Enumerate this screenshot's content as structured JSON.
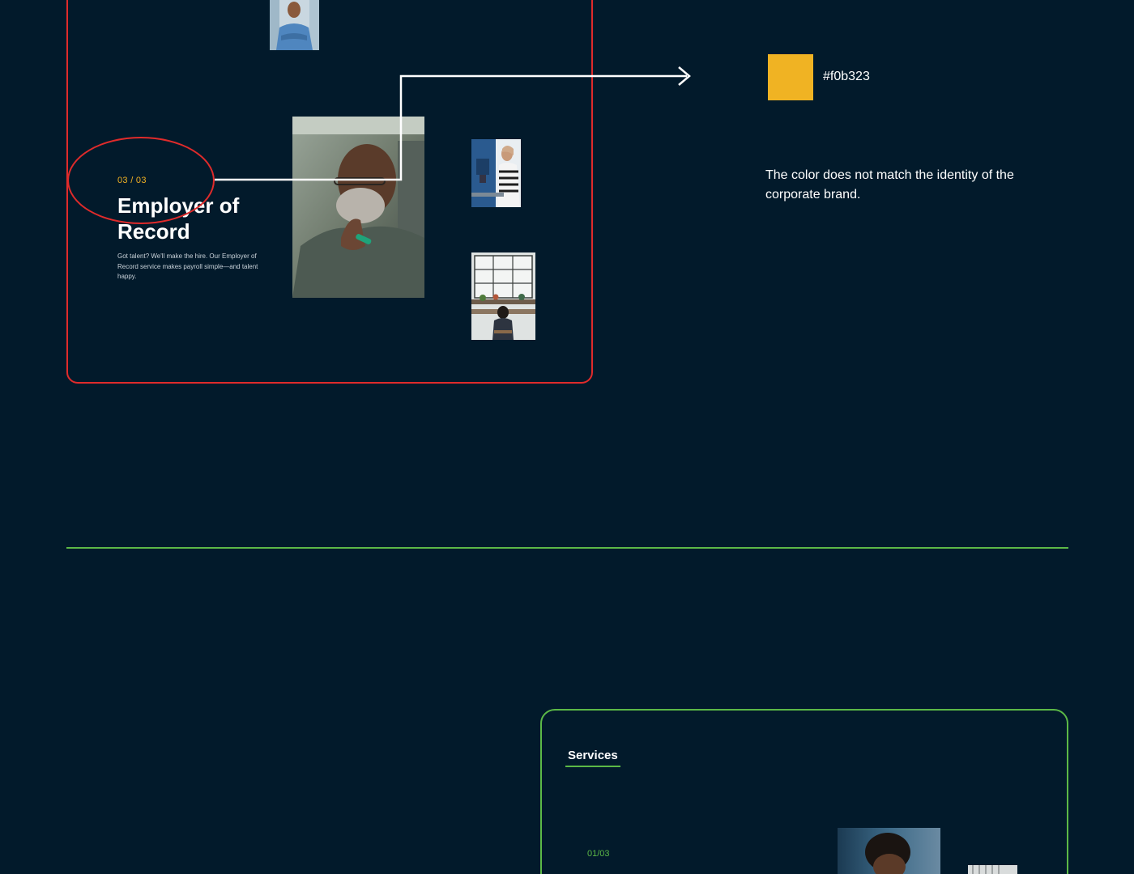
{
  "slide": {
    "counter": "03 / 03",
    "title": "Employer of Record",
    "description": "Got talent? We'll make the hire. Our Employer of Record service makes payroll simple—and talent happy."
  },
  "annotation": {
    "color_hex": "#f0b323",
    "swatch_color": "#f0b323",
    "note": "The color does not match the identity of the corporate brand."
  },
  "services_section": {
    "tab_label": "Services",
    "counter": "01/03"
  },
  "colors": {
    "background": "#021a2b",
    "highlight_red": "#e02b2b",
    "accent_green": "#5cb947",
    "accent_yellow": "#f0b323"
  }
}
